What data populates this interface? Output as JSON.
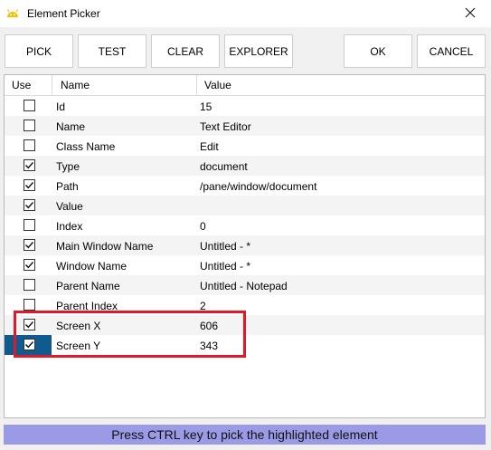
{
  "window": {
    "title": "Element Picker",
    "app_icon": "android-robot-icon",
    "close_icon": "close-x-icon"
  },
  "toolbar": {
    "pick_label": "PICK",
    "test_label": "TEST",
    "clear_label": "CLEAR",
    "explorer_label": "EXPLORER",
    "ok_label": "OK",
    "cancel_label": "CANCEL"
  },
  "table": {
    "headers": [
      "Use",
      "Name",
      "Value"
    ],
    "rows": [
      {
        "use": false,
        "name": "Id",
        "value": "15"
      },
      {
        "use": false,
        "name": "Name",
        "value": "Text Editor"
      },
      {
        "use": false,
        "name": "Class Name",
        "value": "Edit"
      },
      {
        "use": true,
        "name": "Type",
        "value": "document"
      },
      {
        "use": true,
        "name": "Path",
        "value": "/pane/window/document"
      },
      {
        "use": true,
        "name": "Value",
        "value": ""
      },
      {
        "use": false,
        "name": "Index",
        "value": "0"
      },
      {
        "use": true,
        "name": "Main Window Name",
        "value": "Untitled - *"
      },
      {
        "use": true,
        "name": "Window Name",
        "value": "Untitled - *"
      },
      {
        "use": false,
        "name": "Parent Name",
        "value": "Untitled - Notepad"
      },
      {
        "use": false,
        "name": "Parent Index",
        "value": "2"
      },
      {
        "use": true,
        "name": "Screen X",
        "value": "606"
      },
      {
        "use": true,
        "name": "Screen Y",
        "value": "343"
      }
    ]
  },
  "status": {
    "message": "Press CTRL key to pick the highlighted element",
    "color": "#9a9ae6"
  },
  "colors": {
    "highlight_border": "#e0192a",
    "current_row_marker": "#0f5a8f"
  }
}
